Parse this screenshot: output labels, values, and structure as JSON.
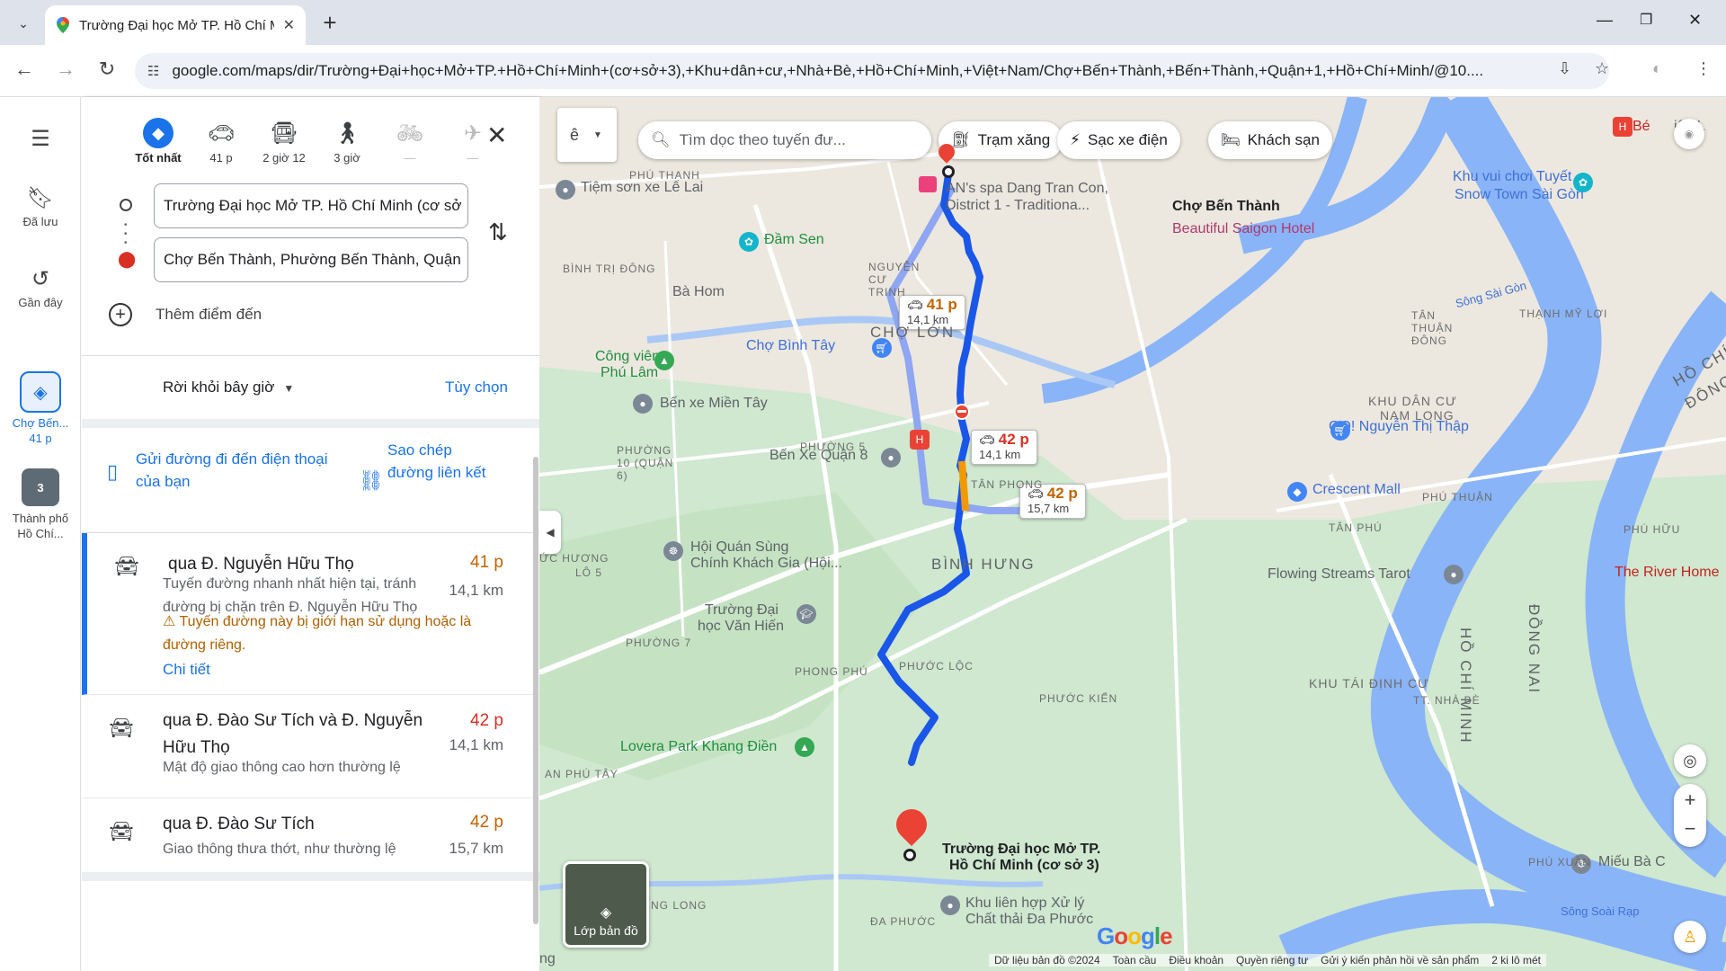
{
  "browser": {
    "tab_title": "Trường Đại học Mở TP. Hồ Chí Minh",
    "url": "google.com/maps/dir/Trường+Đại+học+Mở+TP.+Hồ+Chí+Minh+(cơ+sở+3),+Khu+dân+cư,+Nhà+Bè,+Hồ+Chí+Minh,+Việt+Nam/Chợ+Bến+Thành,+Bến+Thành,+Quận+1,+Hồ+Chí+Minh/@10...."
  },
  "rail": {
    "saved": "Đã lưu",
    "recent": "Gần đây",
    "dir_item": "Chợ Bến...",
    "dir_time": "41 p",
    "city_item": "Thành phố",
    "city_item2": "Hồ Chí..."
  },
  "modes": [
    {
      "label": "Tốt nhất",
      "icon": "best-route-icon"
    },
    {
      "label": "41 p",
      "icon": "car-icon"
    },
    {
      "label": "2 giờ 12",
      "icon": "transit-icon"
    },
    {
      "label": "3 giờ",
      "icon": "walk-icon"
    },
    {
      "label": "—",
      "icon": "bike-icon"
    },
    {
      "label": "—",
      "icon": "flight-icon"
    }
  ],
  "waypoints": {
    "origin": "Trường Đại học Mở TP. Hồ Chí Minh (cơ sở",
    "destination": "Chợ Bến Thành, Phường Bến Thành, Quận",
    "add_destination": "Thêm điểm đến"
  },
  "depart": {
    "label": "Rời khỏi bây giờ",
    "options": "Tùy chọn"
  },
  "share": {
    "send_to_phone": "Gửi đường đi đến điện thoại của bạn",
    "copy_link": "Sao chép đường liên kết"
  },
  "routes": [
    {
      "name": "qua Đ. Nguyễn Hữu Thọ",
      "time": "41 p",
      "time_color": "#c26401",
      "distance": "14,1 km",
      "desc": "Tuyến đường nhanh nhất hiện tại, tránh đường bị chặn trên Đ. Nguyễn Hữu Thọ",
      "warning": "Tuyến đường này bị giới hạn sử dụng hoặc là đường riêng.",
      "details": "Chi tiết"
    },
    {
      "name": "qua Đ. Đào Sư Tích và Đ. Nguyễn Hữu Thọ",
      "time": "42 p",
      "time_color": "#d93025",
      "distance": "14,1 km",
      "desc": "Mật độ giao thông cao hơn thường lệ"
    },
    {
      "name": "qua Đ. Đào Sư Tích",
      "time": "42 p",
      "time_color": "#c26401",
      "distance": "15,7 km",
      "desc": "Giao thông thưa thớt, như thường lệ"
    }
  ],
  "map": {
    "lang": "ê",
    "search_placeholder": "Tìm dọc theo tuyến đư...",
    "chips": [
      "Trạm xăng",
      "Sạc xe điện",
      "Khách sạn"
    ],
    "eta": [
      {
        "time": "41 p",
        "dist": "14,1 km",
        "color": "#c26401"
      },
      {
        "time": "42 p",
        "dist": "14,1 km",
        "color": "#d93025"
      },
      {
        "time": "42 p",
        "dist": "15,7 km",
        "color": "#c26401"
      }
    ],
    "labels": {
      "ben_thanh": "Chợ Bến Thành",
      "hotel": "Beautiful Saigon Hotel",
      "spa": "AN's spa Dang Tran Con, District 1 - Traditiona...",
      "origin_1": "Trường Đại học Mở TP.",
      "origin_2": "Hồ Chí Minh (cơ sở 3)",
      "cho_lon": "CHỢ LỚN",
      "binh_hung": "BÌNH HƯNG",
      "khu_dan_cu": "KHU DÂN CƯ",
      "nam_long": "NAM LONG",
      "khu_tai_dinh_cu": "KHU TÁI ĐỊNH CƯ",
      "ho_chi_minh_v": "HỒ CHÍ MINH",
      "dong_nai": "ĐỒNG NAI",
      "ho_chi_minh_r": "HỒ CHÍ",
      "dong_r": "ĐÔNG",
      "cong_vien": "Công viên",
      "phu_lam": "Phú Lâm",
      "dam_sen": "Đầm Sen",
      "cho_binh_tay": "Chợ Bình Tây",
      "ben_xe_mien_tay": "Bến xe Miền Tây",
      "ben_xe_q8": "Bến Xe Quận 8",
      "hoi_quan": "Hội Quán Sùng",
      "hoi_quan2": "Chính Khách Gia (Hội...",
      "van_hien": "Trường Đại",
      "van_hien2": "học Văn Hiến",
      "lovera": "Lovera Park Khang Điền",
      "crescent": "Crescent Mall",
      "go": "GO! Nguyễn Thị Thập",
      "flowing": "Flowing Streams Tarot",
      "river_home": "The River Home",
      "snow": "Khu vui chơi Tuyết",
      "snow2": "Snow Town Sài Gòn",
      "tiem_son": "Tiệm sơn xe Lê Lai",
      "khu_xu_ly": "Khu liên hợp Xử lý",
      "chat_thai": "Chất thải Đa Phước",
      "mieu": "Miếu Bà C",
      "song_sai_gon": "Sông Sài Gòn",
      "song_soai_rap": "Sông Soài Rạp",
      "phu_thanh": "PHÚ THẠNH",
      "binh_tri_dong": "BÌNH TRỊ ĐÔNG",
      "nguyen_cu_trinh": "NGUYỄN CƯ TRINH",
      "tan_thuan_dong": "TÂN THUẬN ĐÔNG",
      "thanh_my_loi": "THẠNH MỸ LỢI",
      "phuong_10": "PHƯỜNG 10 (QUẬN 6)",
      "phuong_5": "PHƯỜNG 5",
      "tan_phong": "TÂN PHONG",
      "phu_thuan": "PHÚ THUẬN",
      "tan_phu": "TÂN PHÚ",
      "phu_huu": "PHÚ HỮU",
      "phuong_7": "PHƯỜNG 7",
      "phong_phu": "PHONG PHÚ",
      "phuoc_loc": "PHƯỚC LỘC",
      "phuoc_kien": "PHƯỚC KIỂN",
      "tt_nha_be": "TT. NHÀ BÈ",
      "an_phu_tay": "AN PHÚ TÂY",
      "da_phuoc": "ĐA PHƯỚC",
      "phu_xuan": "PHÚ XUÂN",
      "hung_long": "NG LONG",
      "duc_huong": "ỨC HƯƠNG",
      "lo_5": "LÔ 5",
      "ba_hom": "Bà Hom",
      "ben_le": "Bé",
      "hotel_right": "iện L",
      "ng": "ng"
    },
    "layers": "Lớp bản đồ",
    "logo": "Google",
    "footer": [
      "Dữ liệu bản đồ ©2024",
      "Toàn cầu",
      "Điều khoản",
      "Quyền riêng tư",
      "Gửi ý kiến phản hồi về sản phẩm",
      "2 ki lô mét"
    ]
  }
}
